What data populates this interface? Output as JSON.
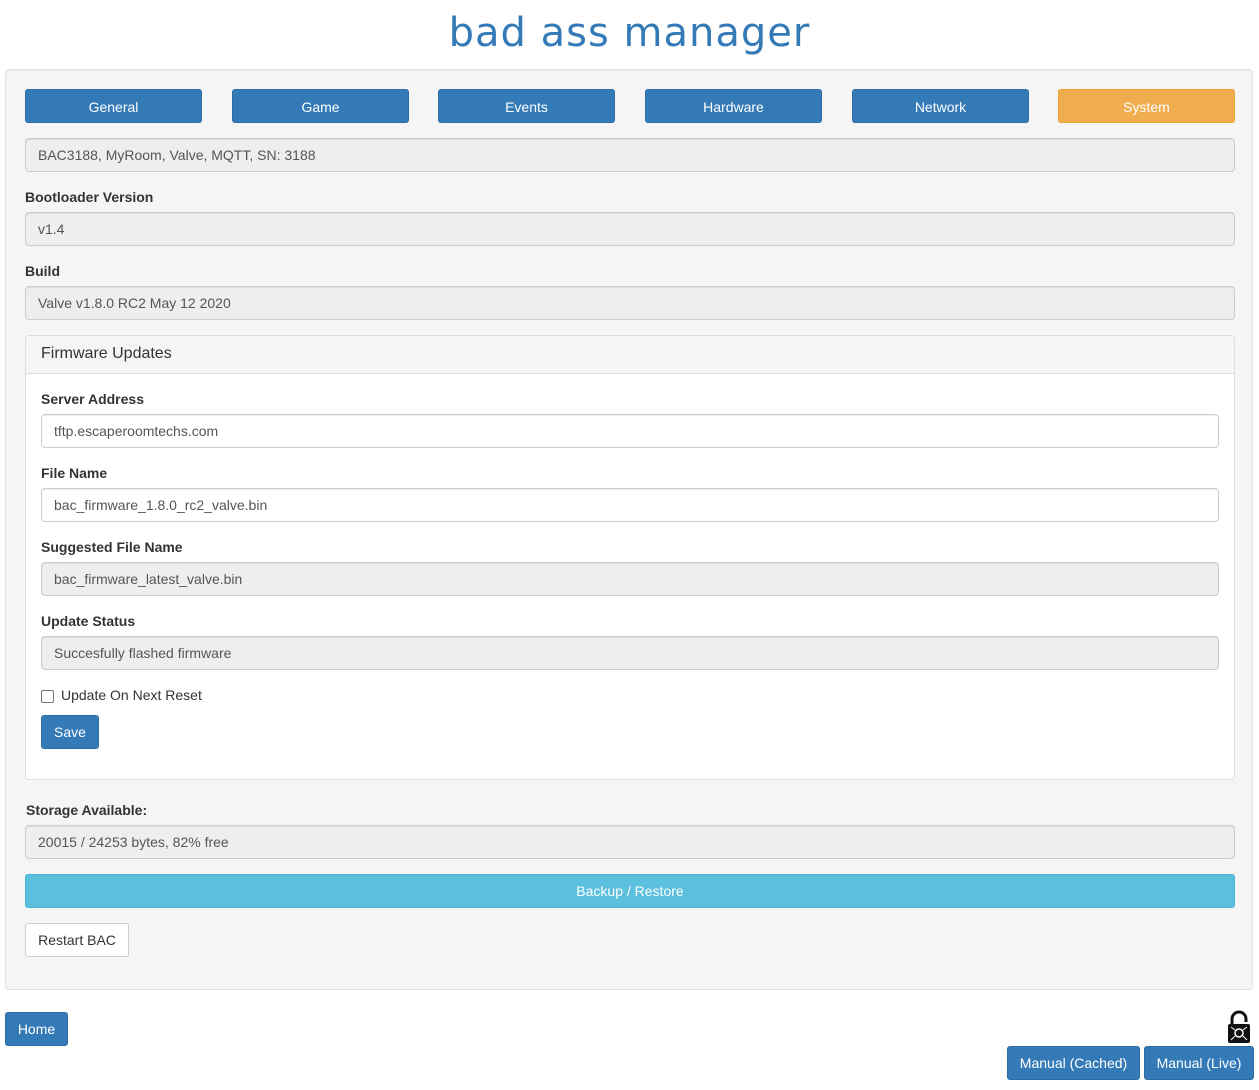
{
  "app": {
    "title": "bad ass manager"
  },
  "tabs": [
    {
      "label": "General"
    },
    {
      "label": "Game"
    },
    {
      "label": "Events"
    },
    {
      "label": "Hardware"
    },
    {
      "label": "Network"
    },
    {
      "label": "System",
      "active": true
    }
  ],
  "device": {
    "info": "BAC3188, MyRoom, Valve, MQTT, SN: 3188"
  },
  "bootloader": {
    "label": "Bootloader Version",
    "value": "v1.4"
  },
  "build": {
    "label": "Build",
    "value": "Valve v1.8.0 RC2 May 12 2020"
  },
  "firmware": {
    "title": "Firmware Updates",
    "server_label": "Server Address",
    "server_value": "tftp.escaperoomtechs.com",
    "file_label": "File Name",
    "file_value": "bac_firmware_1.8.0_rc2_valve.bin",
    "suggested_label": "Suggested File Name",
    "suggested_value": "bac_firmware_latest_valve.bin",
    "status_label": "Update Status",
    "status_value": "Succesfully flashed firmware",
    "reset_checkbox_label": "Update On Next Reset",
    "reset_checked": false,
    "save_label": "Save"
  },
  "storage": {
    "label": "Storage Available:",
    "value": "20015 / 24253 bytes, 82% free"
  },
  "actions": {
    "backup_label": "Backup / Restore",
    "restart_label": "Restart BAC"
  },
  "footer": {
    "home_label": "Home",
    "manual_cached_label": "Manual (Cached)",
    "manual_live_label": "Manual (Live)",
    "lock_icon": "padlock-icon"
  },
  "colors": {
    "primary": "#337ab7",
    "active_tab": "#f0ad4e",
    "info": "#5bc0de"
  }
}
